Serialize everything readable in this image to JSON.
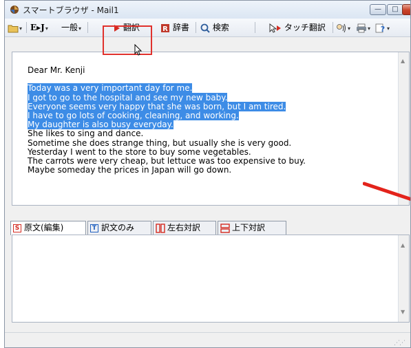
{
  "window": {
    "title": "スマートブラウザ - Mail1",
    "minimize_glyph": "—",
    "maximize_glyph": "□",
    "close_glyph": "✕"
  },
  "toolbar": {
    "ej_label": "E▸J",
    "genre_label": "一般",
    "translate_label": "翻訳",
    "dictionary_label": "辞書",
    "search_label": "検索",
    "touch_translate_label": "タッチ翻訳"
  },
  "editor": {
    "lines": [
      "Dear Mr. Kenji",
      "",
      "Today was a very important day for me.",
      "I got to go to the hospital and see my new baby.",
      "Everyone seems very happy that she was born, but I am tired.",
      "I have to go lots of cooking, cleaning, and working.",
      "My daughter is also busy everyday.",
      "She likes to sing and dance.",
      "Sometime she does strange thing, but usually she is very good.",
      "Yesterday I went to the store to buy some vegetables.",
      "The carrots were very cheap, but lettuce was too expensive to buy.",
      "Maybe someday the prices in Japan will go down."
    ]
  },
  "tabs": [
    {
      "icon": "S",
      "label": "原文(編集)"
    },
    {
      "icon": "T",
      "label": "訳文のみ"
    },
    {
      "icon": "",
      "label": "左右対訳"
    },
    {
      "icon": "",
      "label": "上下対訳"
    }
  ],
  "colors": {
    "selection": "#3d8ce6",
    "highlight_box": "#e0312c",
    "tab_icon_red": "#d42a20",
    "tab_icon_blue": "#1f5fbf"
  }
}
